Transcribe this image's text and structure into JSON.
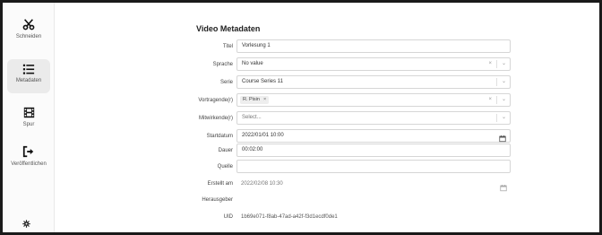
{
  "sidebar": {
    "items": [
      {
        "label": "Schneiden",
        "icon": "scissors-icon"
      },
      {
        "label": "Metadaten",
        "icon": "list-icon"
      },
      {
        "label": "Spur",
        "icon": "film-icon"
      },
      {
        "label": "Veröffentlichen",
        "icon": "sign-out-icon"
      }
    ],
    "settings_icon": "gear-icon"
  },
  "main": {
    "title": "Video Metadaten",
    "fields": {
      "titel": {
        "label": "Titel",
        "value": "Vorlesung 1"
      },
      "sprache": {
        "label": "Sprache",
        "value": "No value"
      },
      "serie": {
        "label": "Serie",
        "value": "Course Series 11"
      },
      "vortragende": {
        "label": "Vortragende(r)",
        "tag": "R. Pisin"
      },
      "mitwirkende": {
        "label": "Mitwirkende(r)",
        "placeholder": "Select..."
      },
      "startdatum": {
        "label": "Startdatum",
        "value": "2022/01/01 10:00"
      },
      "dauer": {
        "label": "Dauer",
        "value": "00:02:00"
      },
      "quelle": {
        "label": "Quelle",
        "value": ""
      },
      "erstellt": {
        "label": "Erstellt am",
        "value": "2022/02/08 10:30"
      },
      "herausgeber": {
        "label": "Herausgeber",
        "value": ""
      },
      "uid": {
        "label": "UID",
        "value": "1b69e071-f8ab-47ad-a42f-f3d1ecdf0de1"
      }
    },
    "clear_glyph": "×",
    "chevron_glyph": "⌄"
  },
  "colors": {
    "frame": "#1a1a1a",
    "sidebar_active": "#ebebeb",
    "field_border": "#d6d6d6"
  }
}
